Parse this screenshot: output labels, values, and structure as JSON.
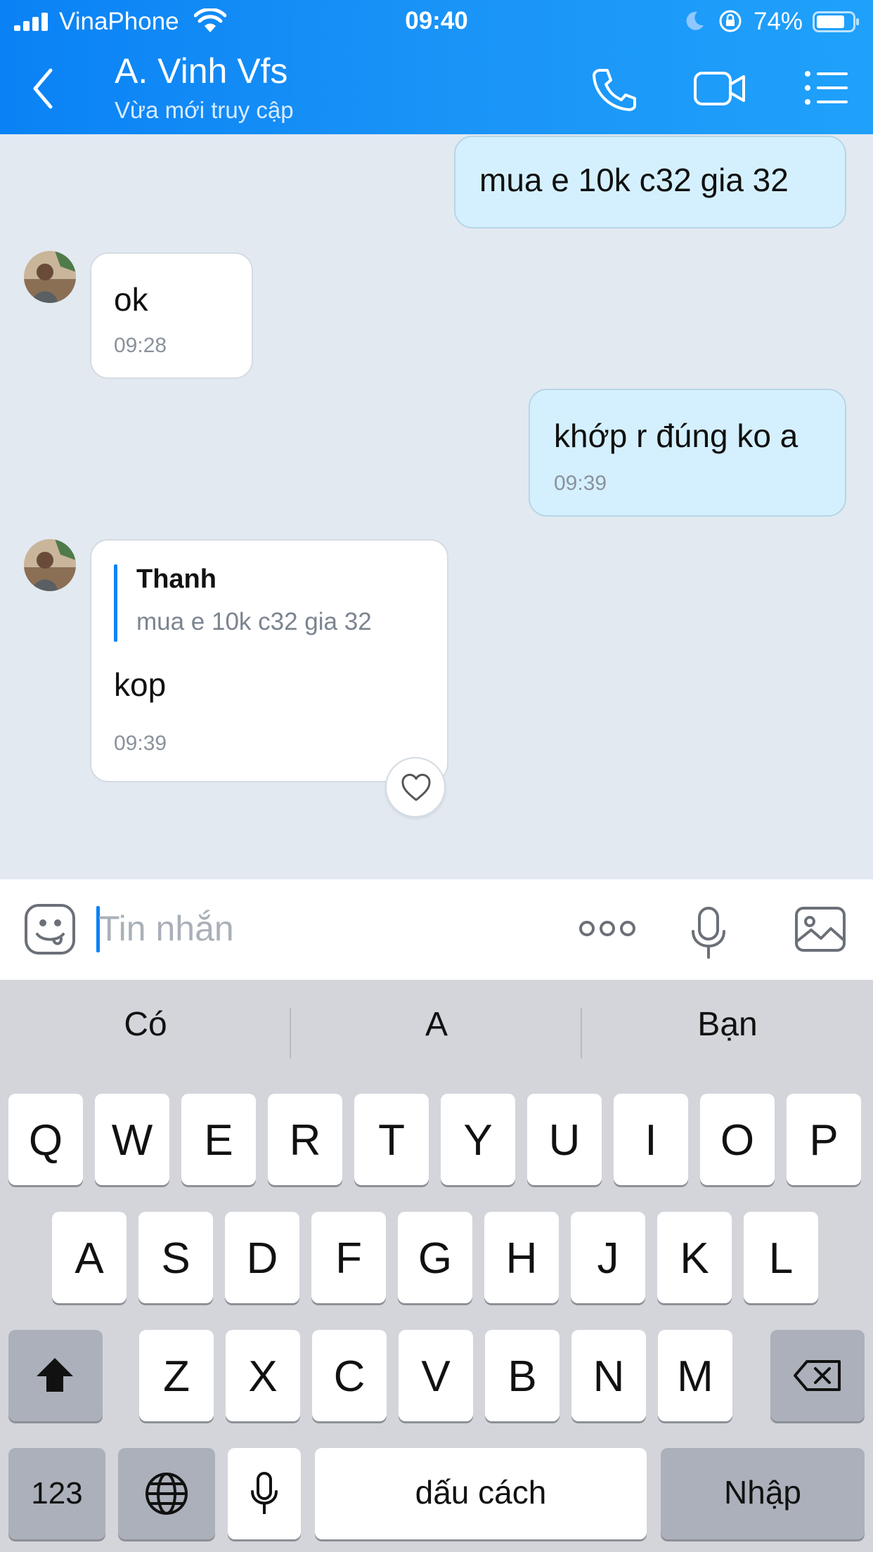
{
  "status_bar": {
    "carrier": "VinaPhone",
    "time": "09:40",
    "battery": "74%"
  },
  "header": {
    "title": "A. Vinh Vfs",
    "subtitle": "Vừa mới truy cập"
  },
  "messages": [
    {
      "direction": "out",
      "text": "mua e 10k c32 gia 32"
    },
    {
      "direction": "in",
      "text": "ok",
      "time": "09:28"
    },
    {
      "direction": "out",
      "text": "khớp r đúng ko a",
      "time": "09:39"
    },
    {
      "direction": "in",
      "quote_name": "Thanh",
      "quote_text": "mua e 10k c32 gia 32",
      "text": "kop",
      "time": "09:39"
    }
  ],
  "input": {
    "placeholder": "Tin nhắn",
    "value": ""
  },
  "keyboard": {
    "suggestions": [
      "Có",
      "A",
      "Bạn"
    ],
    "row1": [
      "Q",
      "W",
      "E",
      "R",
      "T",
      "Y",
      "U",
      "I",
      "O",
      "P"
    ],
    "row2": [
      "A",
      "S",
      "D",
      "F",
      "G",
      "H",
      "J",
      "K",
      "L"
    ],
    "row3": [
      "Z",
      "X",
      "C",
      "V",
      "B",
      "N",
      "M"
    ],
    "numbers_key": "123",
    "space_key": "dấu cách",
    "return_key": "Nhập"
  },
  "colors": {
    "accent": "#0a82f5",
    "outgoing_bubble": "#d4f0ff",
    "chat_bg": "#e2e9f1",
    "keyboard_bg": "#d3d5db"
  },
  "icons": [
    "signal-icon",
    "wifi-icon",
    "moon-icon",
    "rotation-lock-icon",
    "battery-icon",
    "back-icon",
    "phone-icon",
    "video-call-icon",
    "menu-icon",
    "avatar",
    "heart-icon",
    "emoji-icon",
    "more-icon",
    "microphone-icon",
    "image-icon",
    "shift-icon",
    "backspace-icon",
    "globe-icon",
    "dictation-icon"
  ]
}
